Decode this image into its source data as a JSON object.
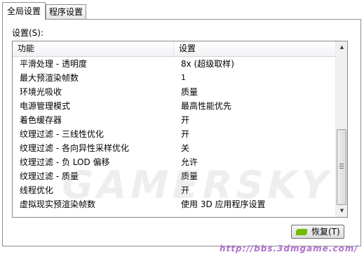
{
  "tabs": [
    {
      "label": "全局设置",
      "active": true
    },
    {
      "label": "程序设置",
      "active": false
    }
  ],
  "settings_label": "设置(S):",
  "columns": {
    "feature": "功能",
    "setting": "设置"
  },
  "rows": [
    {
      "feature": "平滑处理 - 透明度",
      "value": "8x (超级取样)"
    },
    {
      "feature": "最大预渲染帧数",
      "value": "1"
    },
    {
      "feature": "环境光吸收",
      "value": "质量"
    },
    {
      "feature": "电源管理模式",
      "value": "最高性能优先"
    },
    {
      "feature": "着色缓存器",
      "value": "开"
    },
    {
      "feature": "纹理过滤 - 三线性优化",
      "value": "开"
    },
    {
      "feature": "纹理过滤 - 各向异性采样优化",
      "value": "关"
    },
    {
      "feature": "纹理过滤 - 负 LOD 偏移",
      "value": "允许"
    },
    {
      "feature": "纹理过滤 - 质量",
      "value": "质量"
    },
    {
      "feature": "线程优化",
      "value": "开"
    },
    {
      "feature": "虚拟现实预渲染帧数",
      "value": "使用 3D 应用程序设置"
    }
  ],
  "restore_button": {
    "label": "恢复(T)",
    "icon": "nvidia-icon",
    "icon_color": "#76b900"
  },
  "scrollbar": {
    "up_icon": "scroll-up-arrow-icon",
    "down_icon": "scroll-down-arrow-icon",
    "position": 0.72
  },
  "watermark": {
    "logo_text": "GAMERSKY",
    "url_text": "http://bbs.3dmgame.com/"
  }
}
